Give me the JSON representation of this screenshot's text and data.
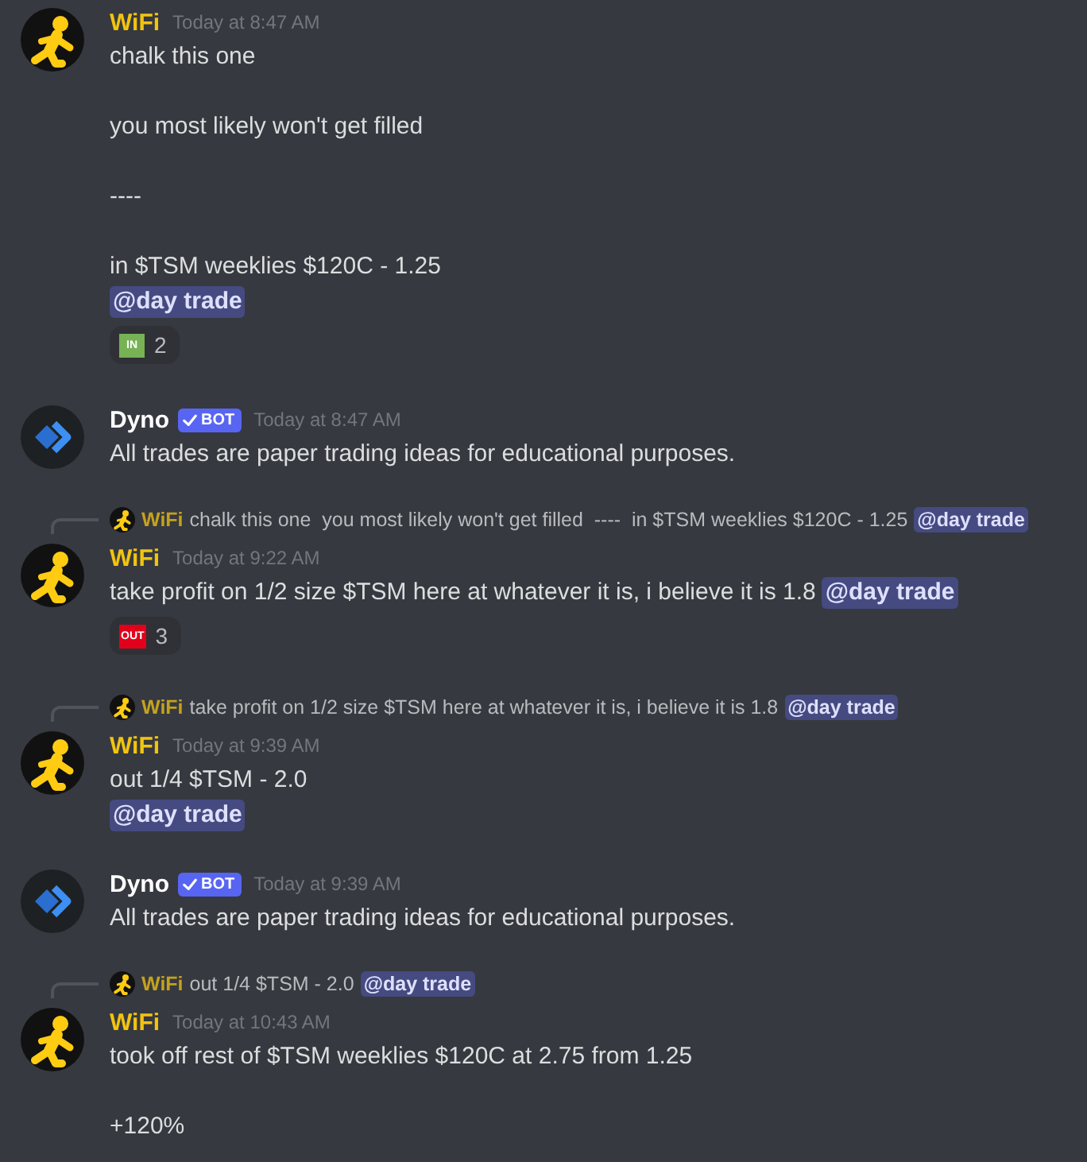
{
  "messages": [
    {
      "author": {
        "kind": "user",
        "name": "WiFi",
        "color": "#f1c40f"
      },
      "timestamp": "Today at 8:47 AM",
      "paragraphs": [
        [
          [
            {
              "kind": "text",
              "text": "chalk this one"
            }
          ]
        ],
        [
          [
            {
              "kind": "text",
              "text": "you most likely won't get filled"
            }
          ]
        ],
        [
          [
            {
              "kind": "text",
              "text": "----"
            }
          ]
        ],
        [
          [
            {
              "kind": "text",
              "text": "in $TSM weeklies $120C - 1.25"
            }
          ],
          [
            {
              "kind": "mention",
              "text": "@day trade"
            }
          ]
        ]
      ],
      "reactions": [
        {
          "emoji_text": "IN",
          "color": "#77b255",
          "count": "2"
        }
      ]
    },
    {
      "author": {
        "kind": "bot",
        "name": "Dyno",
        "color": "#ffffff",
        "tag": {
          "label": "BOT",
          "verified": true
        }
      },
      "timestamp": "Today at 8:47 AM",
      "paragraphs": [
        [
          [
            {
              "kind": "text",
              "text": "All trades are paper trading ideas for educational purposes."
            }
          ]
        ]
      ]
    },
    {
      "reply": {
        "author": {
          "kind": "user",
          "name": "WiFi",
          "color": "#c4a21e"
        },
        "segments": [
          {
            "kind": "text",
            "text": "chalk this one  you most likely won't get filled  ----  in $TSM weeklies $120C - 1.25"
          },
          {
            "kind": "mention",
            "text": "@day trade"
          }
        ]
      },
      "author": {
        "kind": "user",
        "name": "WiFi",
        "color": "#f1c40f"
      },
      "timestamp": "Today at 9:22 AM",
      "paragraphs": [
        [
          [
            {
              "kind": "text",
              "text": "take profit on 1/2 size $TSM here at whatever it is, i believe it is 1.8"
            },
            {
              "kind": "mention",
              "text": "@day trade"
            }
          ]
        ]
      ],
      "reactions": [
        {
          "emoji_text": "OUT",
          "color": "#e2001a",
          "count": "3"
        }
      ]
    },
    {
      "reply": {
        "author": {
          "kind": "user",
          "name": "WiFi",
          "color": "#c4a21e"
        },
        "segments": [
          {
            "kind": "text",
            "text": "take profit on 1/2 size $TSM here at whatever it is, i believe it is 1.8"
          },
          {
            "kind": "mention",
            "text": "@day trade"
          }
        ]
      },
      "author": {
        "kind": "user",
        "name": "WiFi",
        "color": "#f1c40f"
      },
      "timestamp": "Today at 9:39 AM",
      "paragraphs": [
        [
          [
            {
              "kind": "text",
              "text": "out 1/4 $TSM - 2.0"
            }
          ],
          [
            {
              "kind": "mention",
              "text": "@day trade"
            }
          ]
        ]
      ]
    },
    {
      "author": {
        "kind": "bot",
        "name": "Dyno",
        "color": "#ffffff",
        "tag": {
          "label": "BOT",
          "verified": true
        }
      },
      "timestamp": "Today at 9:39 AM",
      "paragraphs": [
        [
          [
            {
              "kind": "text",
              "text": "All trades are paper trading ideas for educational purposes."
            }
          ]
        ]
      ]
    },
    {
      "reply": {
        "author": {
          "kind": "user",
          "name": "WiFi",
          "color": "#c4a21e"
        },
        "segments": [
          {
            "kind": "text",
            "text": "out 1/4 $TSM - 2.0"
          },
          {
            "kind": "mention",
            "text": "@day trade"
          }
        ]
      },
      "author": {
        "kind": "user",
        "name": "WiFi",
        "color": "#f1c40f"
      },
      "timestamp": "Today at 10:43 AM",
      "paragraphs": [
        [
          [
            {
              "kind": "text",
              "text": "took off rest of $TSM weeklies $120C at 2.75 from 1.25"
            }
          ]
        ],
        [
          [
            {
              "kind": "text",
              "text": "+120%"
            }
          ]
        ]
      ]
    }
  ]
}
